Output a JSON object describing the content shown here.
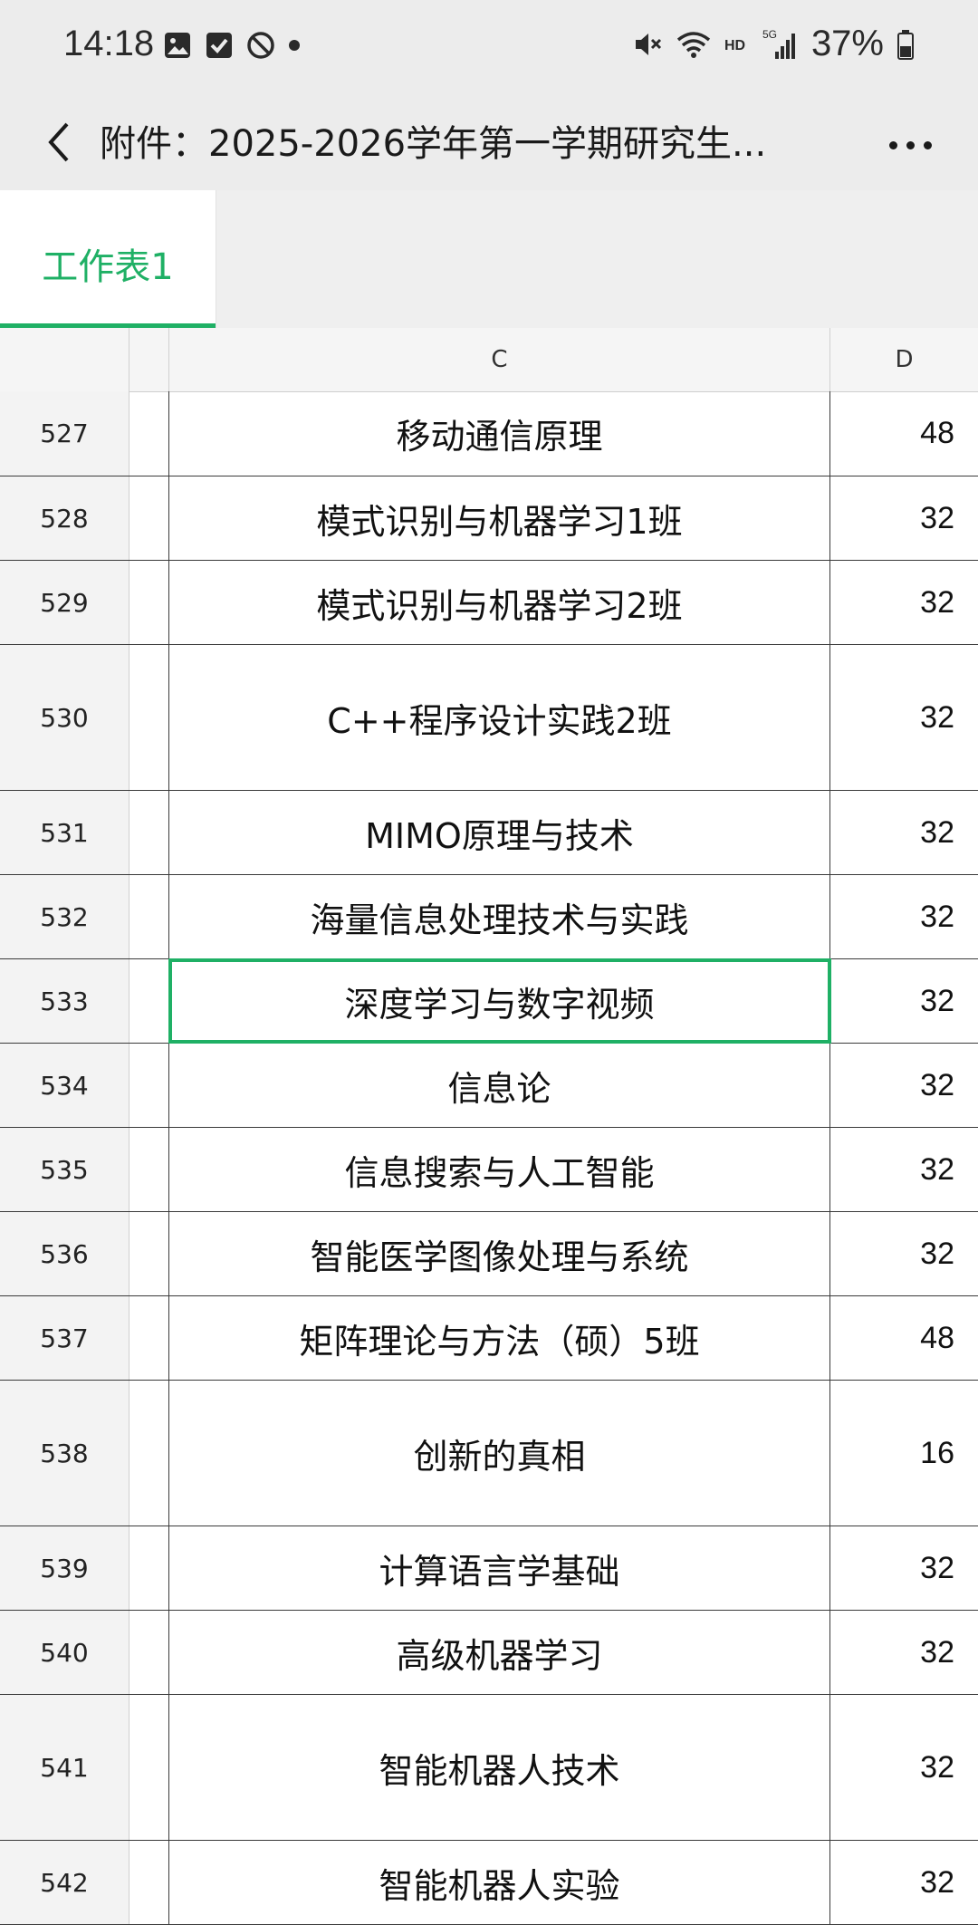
{
  "status_bar": {
    "time": "14:18",
    "battery_text": "37%",
    "left_icons": [
      "gallery-icon",
      "check-icon",
      "blocked-icon",
      "dot-icon"
    ],
    "right_icons": [
      "mute-icon",
      "wifi-icon",
      "hd-icon",
      "signal-5g-icon",
      "battery-icon"
    ]
  },
  "titlebar": {
    "title": "附件：2025-2026学年第一学期研究生..."
  },
  "tabs": [
    {
      "label": "工作表1",
      "active": true
    }
  ],
  "grid": {
    "columns": [
      "C",
      "D"
    ],
    "rows": [
      {
        "num": "527",
        "c": "移动通信原理",
        "d": "48"
      },
      {
        "num": "528",
        "c": "模式识别与机器学习1班",
        "d": "32"
      },
      {
        "num": "529",
        "c": "模式识别与机器学习2班",
        "d": "32"
      },
      {
        "num": "530",
        "c": "C++程序设计实践2班",
        "d": "32"
      },
      {
        "num": "531",
        "c": "MIMO原理与技术",
        "d": "32"
      },
      {
        "num": "532",
        "c": "海量信息处理技术与实践",
        "d": "32"
      },
      {
        "num": "533",
        "c": "深度学习与数字视频",
        "d": "32"
      },
      {
        "num": "534",
        "c": "信息论",
        "d": "32"
      },
      {
        "num": "535",
        "c": "信息搜索与人工智能",
        "d": "32"
      },
      {
        "num": "536",
        "c": "智能医学图像处理与系统",
        "d": "32"
      },
      {
        "num": "537",
        "c": "矩阵理论与方法（硕）5班",
        "d": "48"
      },
      {
        "num": "538",
        "c": "创新的真相",
        "d": "16"
      },
      {
        "num": "539",
        "c": "计算语言学基础",
        "d": "32"
      },
      {
        "num": "540",
        "c": "高级机器学习",
        "d": "32"
      },
      {
        "num": "541",
        "c": "智能机器人技术",
        "d": "32"
      },
      {
        "num": "542",
        "c": "智能机器人实验",
        "d": "32"
      }
    ],
    "selected_row": "533"
  },
  "colors": {
    "accent": "#1fb065",
    "chrome_bg": "#ececec",
    "header_bg": "#f5f5f5"
  }
}
